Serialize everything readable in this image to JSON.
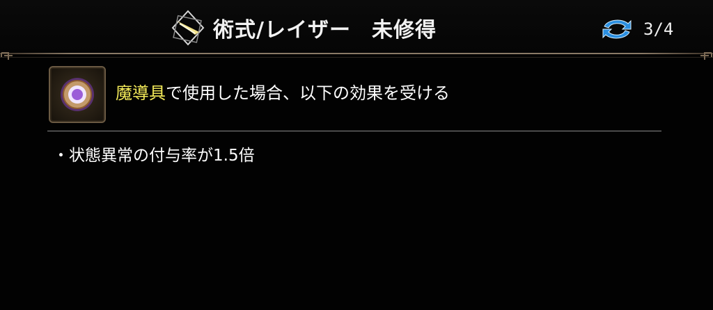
{
  "header": {
    "title": "術式/レイザー",
    "status": "未修得",
    "page": "3/4",
    "title_icon": "laser-skill-icon",
    "swap_icon": "cycle-arrows-icon"
  },
  "item": {
    "icon": "magic-tool-icon",
    "highlight": "魔導具",
    "effect_text": "で使用した場合、以下の効果を受ける"
  },
  "effects": [
    "・状態異常の付与率が1.5倍"
  ],
  "colors": {
    "highlight": "#f5ec5a",
    "swap_icon_blue": "#2a8ee0",
    "border": "#8a7a66"
  }
}
